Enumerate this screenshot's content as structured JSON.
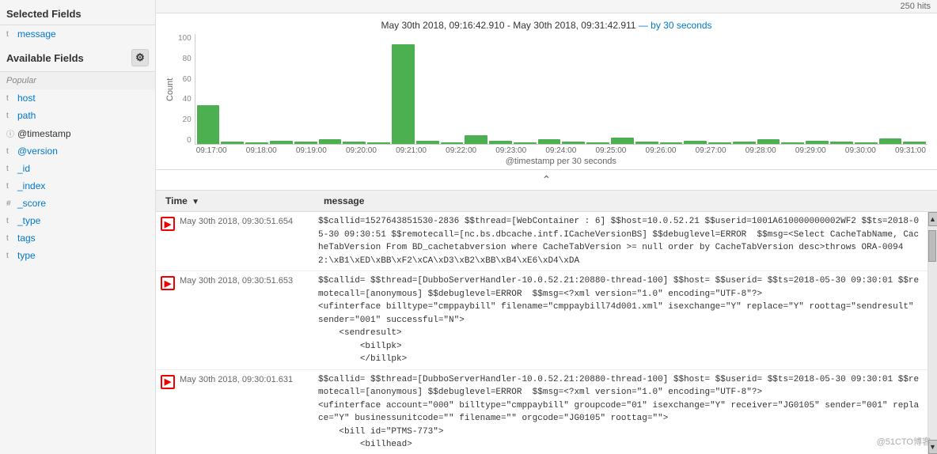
{
  "sidebar": {
    "selected_fields_title": "Selected Fields",
    "selected_fields": [
      {
        "name": "message",
        "type": "t"
      }
    ],
    "available_fields_title": "Available Fields",
    "popular_label": "Popular",
    "popular_fields": [
      {
        "name": "host",
        "type": "t"
      },
      {
        "name": "path",
        "type": "t"
      },
      {
        "name": "@timestamp",
        "type": "@"
      },
      {
        "name": "@version",
        "type": "t"
      },
      {
        "name": "_id",
        "type": "t"
      },
      {
        "name": "_index",
        "type": "t"
      },
      {
        "name": "_score",
        "type": "#"
      },
      {
        "name": "_type",
        "type": "t"
      },
      {
        "name": "tags",
        "type": "t"
      },
      {
        "name": "type",
        "type": "t"
      }
    ]
  },
  "chart": {
    "title": "May 30th 2018, 09:16:42.910 - May 30th 2018, 09:31:42.911",
    "by_label": "— by 30 seconds",
    "x_axis_title": "@timestamp per 30 seconds",
    "y_axis_label": "Count",
    "y_ticks": [
      "100",
      "80",
      "60",
      "40",
      "20",
      "0"
    ],
    "x_labels": [
      "09:17:00",
      "09:18:00",
      "09:19:00",
      "09:20:00",
      "09:21:00",
      "09:22:00",
      "09:23:00",
      "09:24:00",
      "09:25:00",
      "09:26:00",
      "09:27:00",
      "09:28:00",
      "09:29:00",
      "09:30:00",
      "09:31:00"
    ],
    "bars": [
      35,
      2,
      1,
      3,
      2,
      4,
      2,
      1,
      90,
      3,
      1,
      8,
      3,
      1,
      4,
      2,
      1,
      6,
      2,
      1,
      3,
      1,
      2,
      4,
      1,
      3,
      2,
      1,
      5,
      2
    ]
  },
  "results": {
    "count_text": "250 hits",
    "col_time": "Time",
    "col_message": "message",
    "rows": [
      {
        "time": "May 30th 2018, 09:30:51.654",
        "message": "$$callid=1527643851530-2836 $$thread=[WebContainer : 6] $$host=10.0.52.21 $$userid=1001A610000000002WF2 $$ts=2018-05-30 09:30:51 $$remotecall=[nc.bs.dbcache.intf.ICacheVersionBS] $$debuglevel=ERROR  $$msg=<Select CacheTabName, CacheTabVersion From BD_cachetabversion where CacheTabVersion >= null order by CacheTabVersion desc>throws ORA-00942:\\xB1\\xED\\xBB\\xF2\\xCA\\xD3\\xB2\\xBB\\xB4\\xE6\\xD4\\xDA"
      },
      {
        "time": "May 30th 2018, 09:30:51.653",
        "message": "$$callid= $$thread=[DubboServerHandler-10.0.52.21:20880-thread-100] $$host= $$userid= $$ts=2018-05-30 09:30:01 $$remotecall=[anonymous] $$debuglevel=ERROR  $$msg=<?xml version=\"1.0\" encoding=\"UTF-8\"?>\n<ufinterface billtype=\"cmppaybill\" filename=\"cmppaybill74d001.xml\" isexchange=\"Y\" replace=\"Y\" roottag=\"sendresult\" sender=\"001\" successful=\"N\">\n    <sendresult>\n        <billpk>\n        </billpk>"
      },
      {
        "time": "May 30th 2018, 09:30:01.631",
        "message": "$$callid= $$thread=[DubboServerHandler-10.0.52.21:20880-thread-100] $$host= $$userid= $$ts=2018-05-30 09:30:01 $$remotecall=[anonymous] $$debuglevel=ERROR  $$msg=<?xml version=\"1.0\" encoding=\"UTF-8\"?>\n<ufinterface account=\"000\" billtype=\"cmppaybill\" groupcode=\"01\" isexchange=\"Y\" receiver=\"JG0105\" sender=\"001\" replace=\"Y\" businessunitcode=\"\" filename=\"\" orgcode=\"JG0105\" roottag=\"\">\n    <bill id=\"PTMS-773\">\n        <billhead>"
      }
    ]
  },
  "watermark": "@51CTO博客"
}
